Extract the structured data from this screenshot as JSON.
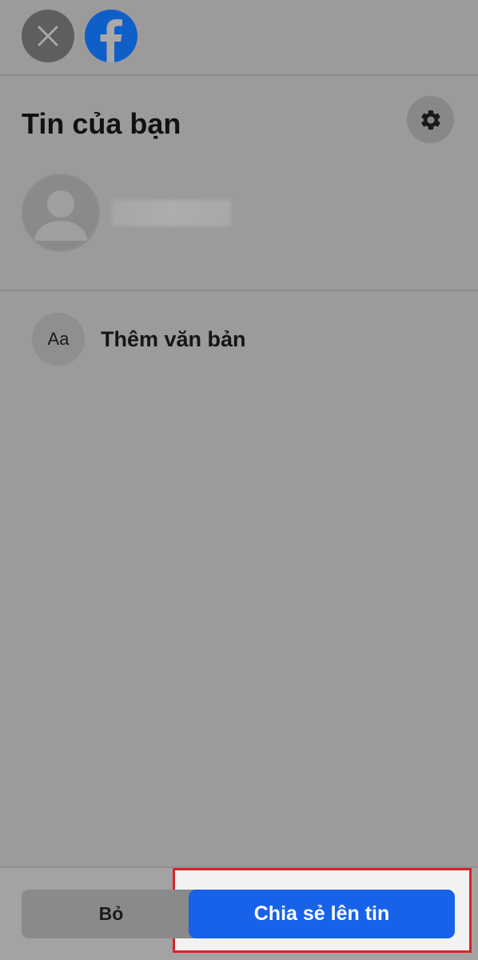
{
  "header": {
    "close_icon": "close-icon",
    "logo_icon": "facebook-logo-icon"
  },
  "story": {
    "title": "Tin của bạn",
    "settings_icon": "gear-icon",
    "avatar_icon": "default-avatar-icon"
  },
  "options": [
    {
      "icon_text": "Aa",
      "label": "Thêm văn bản"
    }
  ],
  "footer": {
    "discard_label": "Bỏ",
    "share_label": "Chia sẻ lên tin"
  },
  "colors": {
    "overlay_background": "#9b9b9b",
    "share_button": "#1762e8",
    "highlight_border": "#d9222a",
    "facebook_blue": "#0f5fc9"
  }
}
